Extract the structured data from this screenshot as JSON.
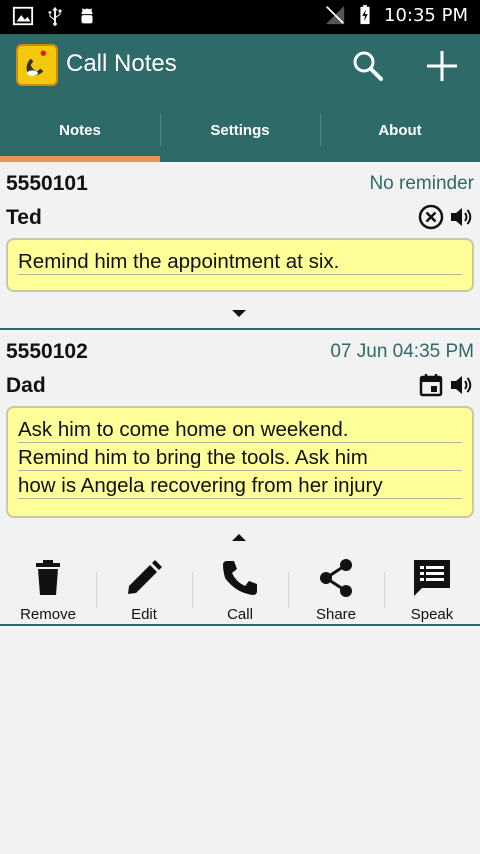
{
  "status_bar": {
    "time": "10:35 PM"
  },
  "app_bar": {
    "title": "Call Notes"
  },
  "tabs": [
    {
      "label": "Notes",
      "active": true
    },
    {
      "label": "Settings",
      "active": false
    },
    {
      "label": "About",
      "active": false
    }
  ],
  "notes": [
    {
      "number": "5550101",
      "reminder": "No reminder",
      "name": "Ted",
      "lines": [
        "Remind him the appointment at six."
      ],
      "icons": [
        "cancel-reminder-icon",
        "speaker-icon"
      ]
    },
    {
      "number": "5550102",
      "reminder": "07 Jun 04:35 PM",
      "name": "Dad",
      "lines": [
        "Ask him to come home on weekend.",
        "Remind him to bring the tools. Ask him",
        "how is Angela recovering from her injury"
      ],
      "icons": [
        "calendar-icon",
        "speaker-icon"
      ]
    }
  ],
  "actions": [
    {
      "label": "Remove",
      "icon": "trash-icon"
    },
    {
      "label": "Edit",
      "icon": "pencil-icon"
    },
    {
      "label": "Call",
      "icon": "phone-icon"
    },
    {
      "label": "Share",
      "icon": "share-icon"
    },
    {
      "label": "Speak",
      "icon": "speak-icon"
    }
  ],
  "colors": {
    "primary": "#2e6b68",
    "tab_indicator": "#e8955a",
    "note_bg": "#ffff99"
  }
}
